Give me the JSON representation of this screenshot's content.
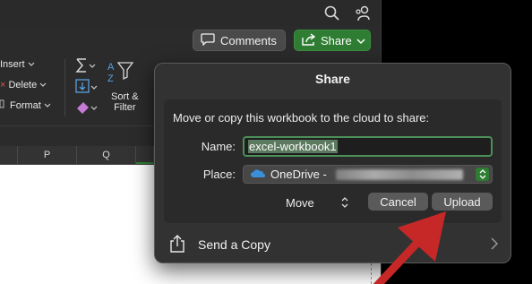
{
  "toolbar": {
    "comments_label": "Comments",
    "share_label": "Share"
  },
  "ribbon": {
    "insert_label": "Insert",
    "delete_label": "Delete",
    "format_label": "Format",
    "sort_filter_line1": "Sort &",
    "sort_filter_line2": "Filter"
  },
  "grid": {
    "columns": [
      "P",
      "Q"
    ]
  },
  "share_dialog": {
    "title": "Share",
    "message": "Move or copy this workbook to the cloud to share:",
    "name_label": "Name:",
    "name_value": "excel-workbook1",
    "place_label": "Place:",
    "place_value": "OneDrive -",
    "move_label": "Move",
    "cancel_label": "Cancel",
    "upload_label": "Upload",
    "send_copy_label": "Send a Copy"
  },
  "colors": {
    "share_green": "#2e7d32",
    "annotation_red": "#c62828",
    "onedrive_blue": "#3b8fd9"
  }
}
